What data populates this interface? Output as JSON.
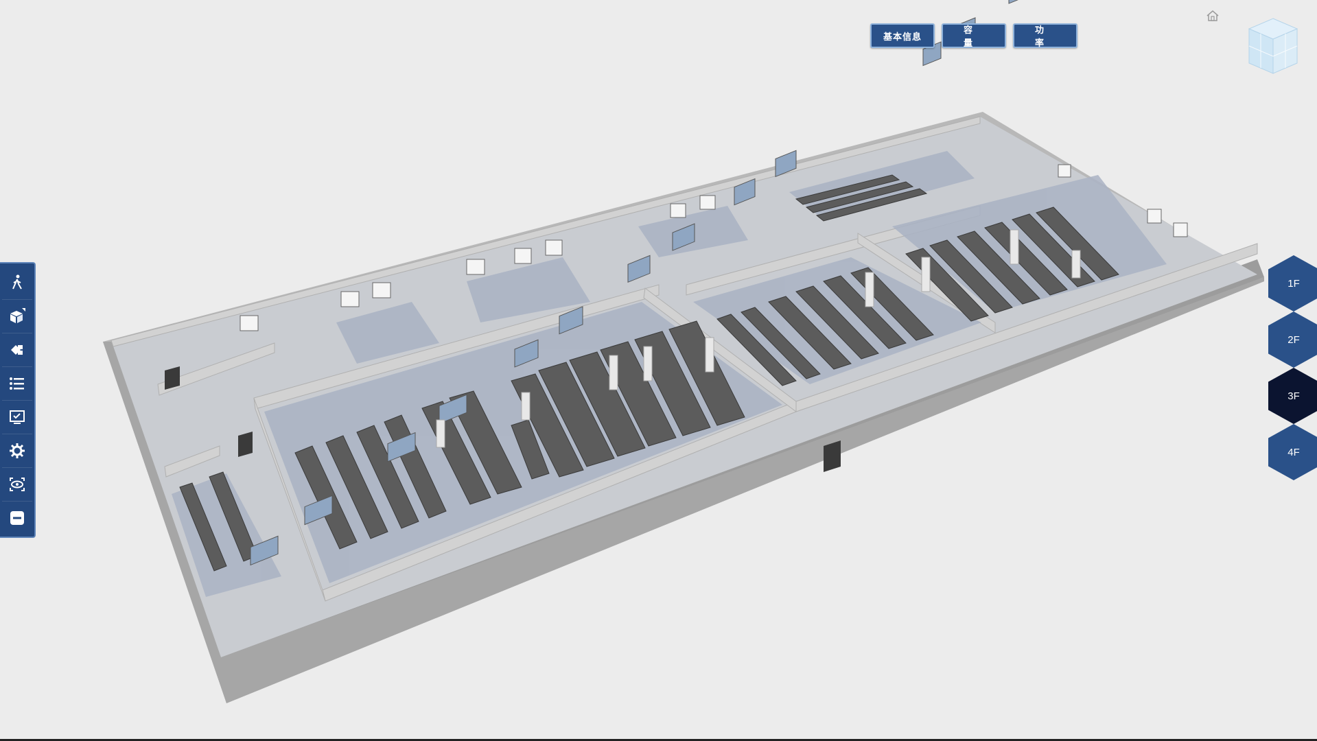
{
  "header": {
    "buttons": [
      {
        "label": "基本信息"
      },
      {
        "label": "容量"
      },
      {
        "label": "功率"
      }
    ]
  },
  "toolbar": {
    "items": [
      {
        "icon": "walk-icon"
      },
      {
        "icon": "cube-icon"
      },
      {
        "icon": "blocks-icon"
      },
      {
        "icon": "list-icon"
      },
      {
        "icon": "monitor-check-icon"
      },
      {
        "icon": "settings-icon"
      },
      {
        "icon": "view-eye-icon"
      },
      {
        "icon": "minus-icon"
      }
    ]
  },
  "floors": {
    "items": [
      {
        "label": "1F"
      },
      {
        "label": "2F"
      },
      {
        "label": "3F"
      },
      {
        "label": "4F"
      }
    ],
    "active": "3F"
  },
  "colors": {
    "accent": "#2a5189",
    "active_floor": "#0b1430",
    "background": "#ececec"
  }
}
